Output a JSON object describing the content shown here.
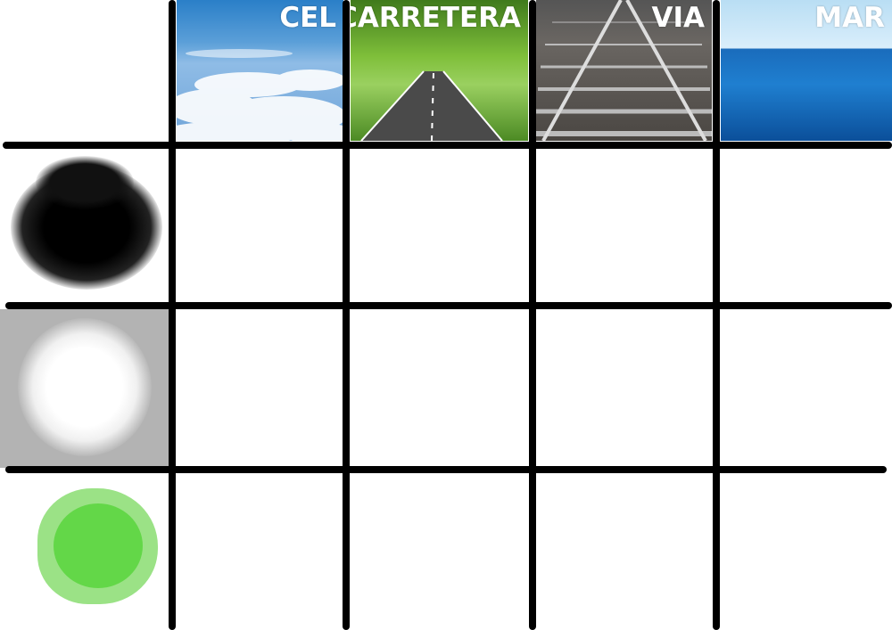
{
  "columns": [
    {
      "label": "CEL",
      "image": "sky-clouds"
    },
    {
      "label": "CARRETERA",
      "image": "tree-lined-road"
    },
    {
      "label": "VIA",
      "image": "railway-track"
    },
    {
      "label": "MAR",
      "image": "sea-waves"
    }
  ],
  "rows": [
    {
      "image": "black-smoke-blot",
      "color": "#000000"
    },
    {
      "image": "white-cloud-blot",
      "color": "#ffffff",
      "background": "#b3b3b3"
    },
    {
      "image": "green-watercolor-blot",
      "color": "#5cd63c"
    }
  ],
  "grid_color": "#000000"
}
